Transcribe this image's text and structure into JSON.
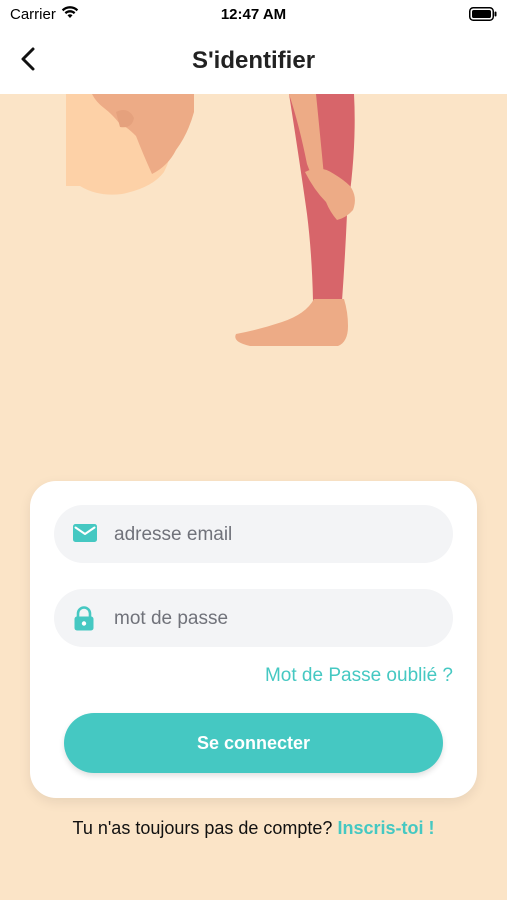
{
  "status_bar": {
    "carrier": "Carrier",
    "time": "12:47 AM"
  },
  "nav": {
    "title": "S'identifier",
    "back_icon": "chevron-left-icon"
  },
  "form": {
    "email_placeholder": "adresse email",
    "email_value": "",
    "email_icon": "mail-icon",
    "password_placeholder": "mot de passe",
    "password_value": "",
    "password_icon": "lock-icon",
    "forgot_password_label": "Mot de Passe oublié ?",
    "submit_label": "Se connecter"
  },
  "signup": {
    "prompt": "Tu n'as toujours pas de compte?",
    "link_label": "Inscris-toi !"
  },
  "colors": {
    "background": "#FBE4C7",
    "accent": "#45C8C2",
    "card": "#FFFFFF",
    "field_background": "#F3F4F6"
  }
}
